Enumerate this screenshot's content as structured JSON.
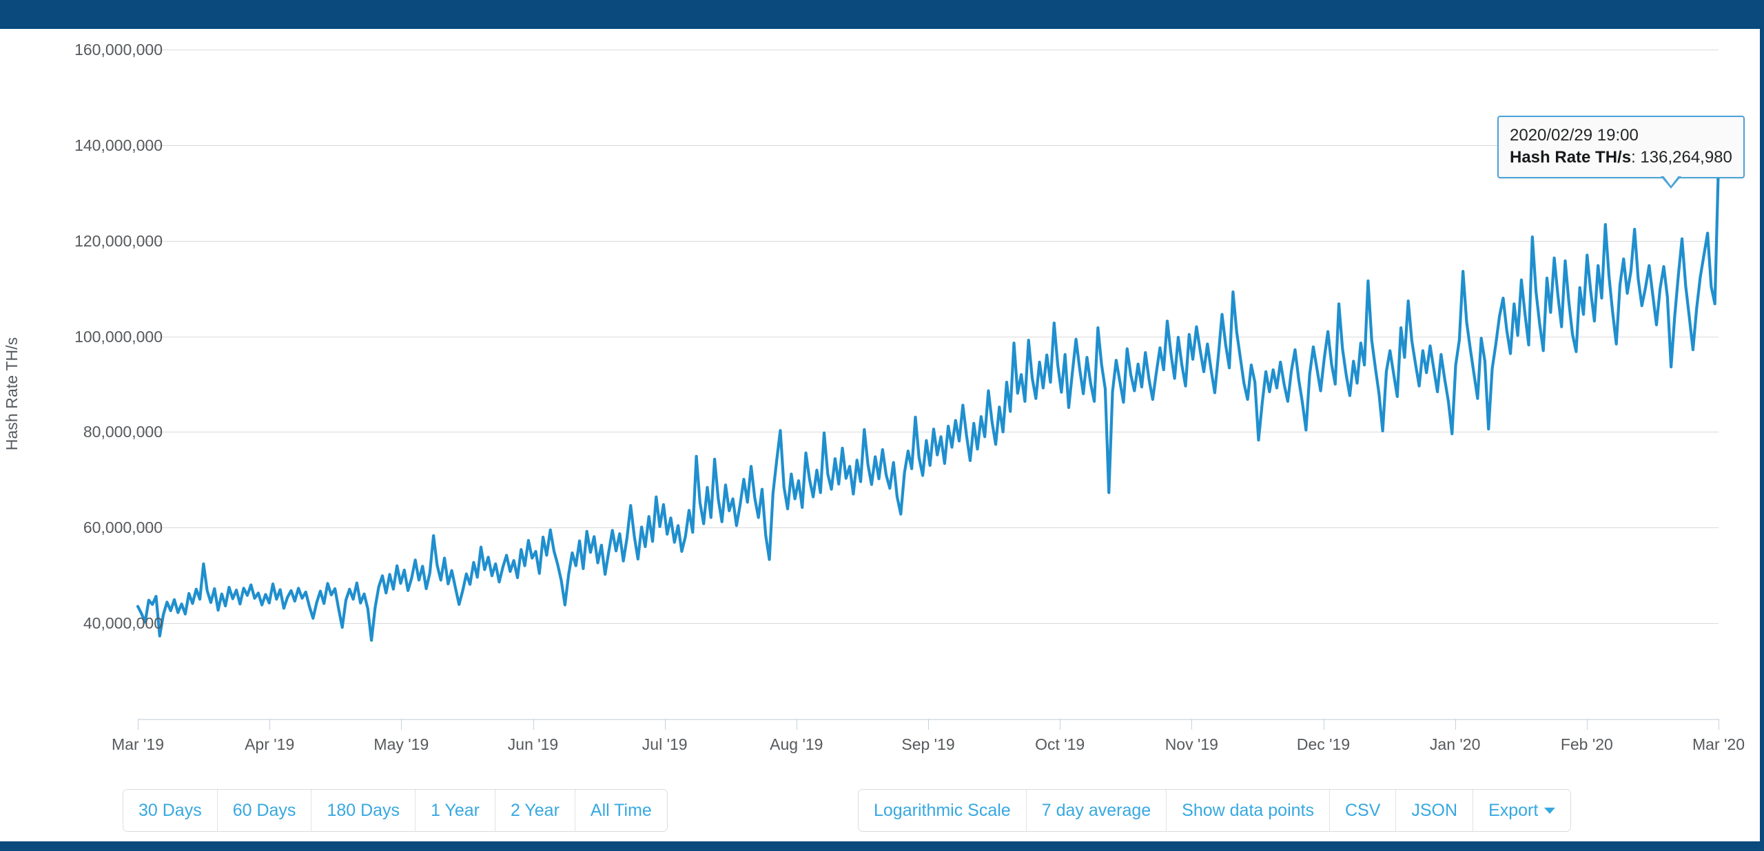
{
  "page": {
    "theme_bar_color": "#0a4a7d",
    "accent_color": "#37a8e0",
    "line_color": "#1f8fce"
  },
  "tooltip": {
    "timestamp": "2020/02/29 19:00",
    "metric_label": "Hash Rate TH/s",
    "separator": ": ",
    "value": "136,264,980"
  },
  "range_buttons": [
    {
      "label": "30 Days",
      "name": "range-30-days"
    },
    {
      "label": "60 Days",
      "name": "range-60-days"
    },
    {
      "label": "180 Days",
      "name": "range-180-days"
    },
    {
      "label": "1 Year",
      "name": "range-1-year"
    },
    {
      "label": "2 Year",
      "name": "range-2-year"
    },
    {
      "label": "All Time",
      "name": "range-all-time"
    }
  ],
  "option_buttons": [
    {
      "label": "Logarithmic Scale",
      "name": "logarithmic-scale-button"
    },
    {
      "label": "7 day average",
      "name": "seven-day-average-button"
    },
    {
      "label": "Show data points",
      "name": "show-data-points-button"
    },
    {
      "label": "CSV",
      "name": "csv-button"
    },
    {
      "label": "JSON",
      "name": "json-button"
    },
    {
      "label": "Export",
      "name": "export-button"
    }
  ],
  "chart_data": {
    "type": "line",
    "title": "",
    "xlabel": "",
    "ylabel": "Hash Rate TH/s",
    "grid": true,
    "legend": "none",
    "ylim": [
      30000000,
      160000000
    ],
    "ytick_labels": [
      "160,000,000",
      "140,000,000",
      "120,000,000",
      "100,000,000",
      "80,000,000",
      "60,000,000",
      "40,000,000"
    ],
    "ytick_values": [
      160000000,
      140000000,
      120000000,
      100000000,
      80000000,
      60000000,
      40000000
    ],
    "xtick_labels": [
      "Mar '19",
      "Apr '19",
      "May '19",
      "Jun '19",
      "Jul '19",
      "Aug '19",
      "Sep '19",
      "Oct '19",
      "Nov '19",
      "Dec '19",
      "Jan '20",
      "Feb '20",
      "Mar '20"
    ],
    "x_range": [
      "2019-03-01",
      "2020-03-01"
    ],
    "units": "TH/s",
    "series": [
      {
        "name": "Hash Rate TH/s",
        "color": "#1f8fce",
        "values": [
          43.5,
          42.0,
          40.2,
          44.8,
          43.9,
          45.6,
          37.3,
          41.8,
          44.4,
          42.6,
          44.9,
          42.2,
          44.0,
          41.9,
          46.2,
          44.1,
          47.1,
          45.0,
          52.4,
          46.8,
          44.3,
          47.2,
          42.7,
          46.1,
          43.6,
          47.5,
          45.1,
          46.9,
          44.0,
          47.3,
          45.8,
          48.0,
          45.2,
          46.3,
          43.8,
          46.0,
          44.2,
          48.2,
          45.0,
          47.0,
          43.1,
          45.4,
          46.8,
          44.6,
          47.3,
          45.2,
          46.5,
          43.5,
          41.0,
          44.3,
          46.7,
          44.1,
          48.3,
          45.9,
          47.2,
          43.0,
          39.1,
          44.8,
          47.1,
          45.0,
          48.4,
          44.2,
          46.1,
          43.0,
          36.4,
          43.2,
          47.6,
          49.9,
          46.3,
          50.2,
          47.1,
          52.0,
          48.3,
          51.1,
          46.8,
          49.4,
          53.2,
          49.0,
          51.9,
          47.2,
          50.5,
          58.3,
          52.1,
          49.0,
          53.6,
          48.2,
          51.0,
          47.4,
          43.9,
          46.8,
          50.3,
          48.1,
          52.7,
          49.6,
          55.9,
          51.2,
          53.8,
          49.9,
          52.4,
          48.6,
          51.7,
          54.2,
          50.8,
          53.1,
          49.5,
          55.4,
          52.0,
          57.3,
          53.6,
          55.0,
          50.4,
          58.0,
          54.2,
          59.5,
          55.1,
          52.3,
          48.9,
          43.8,
          50.1,
          54.7,
          52.0,
          57.2,
          51.4,
          59.2,
          54.8,
          58.1,
          52.6,
          56.3,
          50.2,
          54.9,
          59.4,
          55.1,
          58.7,
          53.0,
          57.8,
          64.6,
          58.2,
          53.4,
          60.1,
          56.0,
          62.3,
          57.1,
          66.4,
          60.2,
          64.8,
          58.6,
          62.0,
          56.9,
          60.4,
          55.0,
          58.1,
          63.6,
          59.0,
          74.9,
          65.2,
          60.8,
          68.4,
          62.1,
          74.3,
          66.0,
          61.2,
          68.9,
          63.5,
          66.0,
          60.4,
          64.8,
          70.1,
          65.3,
          72.8,
          66.2,
          62.1,
          68.0,
          58.4,
          53.3,
          67.2,
          74.0,
          80.3,
          68.5,
          63.9,
          71.2,
          66.0,
          69.8,
          64.2,
          75.6,
          70.1,
          66.4,
          72.0,
          67.3,
          79.8,
          71.2,
          68.0,
          74.4,
          69.1,
          76.6,
          70.3,
          72.8,
          67.0,
          74.1,
          69.6,
          80.5,
          73.2,
          69.0,
          74.8,
          70.2,
          76.3,
          71.0,
          68.2,
          73.6,
          66.4,
          62.8,
          71.4,
          76.0,
          72.3,
          83.1,
          74.6,
          70.9,
          78.2,
          73.0,
          80.6,
          75.2,
          79.0,
          73.4,
          81.2,
          76.8,
          82.4,
          78.1,
          85.6,
          79.3,
          74.0,
          81.8,
          76.4,
          83.2,
          79.0,
          88.6,
          82.1,
          77.4,
          85.2,
          80.0,
          90.4,
          84.3,
          98.6,
          88.1,
          92.0,
          86.4,
          99.2,
          91.3,
          87.0,
          94.6,
          89.2,
          96.1,
          90.4,
          102.8,
          94.0,
          88.3,
          96.2,
          85.1,
          92.4,
          99.4,
          93.2,
          88.0,
          95.6,
          90.2,
          86.4,
          101.8,
          94.1,
          89.0,
          67.3,
          88.4,
          95.0,
          90.6,
          86.2,
          97.4,
          92.0,
          88.6,
          94.2,
          89.4,
          96.6,
          91.0,
          86.8,
          92.4,
          97.6,
          93.0,
          103.2,
          96.4,
          91.2,
          99.8,
          94.0,
          89.6,
          100.4,
          95.2,
          102.0,
          97.1,
          92.6,
          98.4,
          93.0,
          88.2,
          96.0,
          104.6,
          98.2,
          93.4,
          109.3,
          101.0,
          95.6,
          90.2,
          86.8,
          94.0,
          90.4,
          78.3,
          86.0,
          92.6,
          88.4,
          93.0,
          89.2,
          94.6,
          90.0,
          86.4,
          92.8,
          97.2,
          91.0,
          86.2,
          80.4,
          92.0,
          97.8,
          93.2,
          88.6,
          95.4,
          101.0,
          94.2,
          90.0,
          106.8,
          97.4,
          92.0,
          87.6,
          94.8,
          90.2,
          98.6,
          94.0,
          111.6,
          99.2,
          93.4,
          88.0,
          80.2,
          92.6,
          97.0,
          92.2,
          87.4,
          101.8,
          95.6,
          107.4,
          99.0,
          94.2,
          89.6,
          97.0,
          92.4,
          98.0,
          93.2,
          88.4,
          96.2,
          91.0,
          86.4,
          79.6,
          94.0,
          99.2,
          113.6,
          103.0,
          97.4,
          92.2,
          87.0,
          99.6,
          94.8,
          80.6,
          93.2,
          98.4,
          104.2,
          108.0,
          101.2,
          96.4,
          106.8,
          100.2,
          111.8,
          104.6,
          98.2,
          120.8,
          109.4,
          102.6,
          97.0,
          112.2,
          105.0,
          116.4,
          108.6,
          102.0,
          115.8,
          107.2,
          100.4,
          96.8,
          110.2,
          104.6,
          117.0,
          109.4,
          103.2,
          114.8,
          108.0,
          123.4,
          112.6,
          105.0,
          98.4,
          110.8,
          116.2,
          109.0,
          113.6,
          122.4,
          112.0,
          106.4,
          110.2,
          114.8,
          108.6,
          102.4,
          110.0,
          114.6,
          108.2,
          93.6,
          104.2,
          112.8,
          120.4,
          110.6,
          104.0,
          97.2,
          105.8,
          112.4,
          117.0,
          121.6,
          110.4,
          106.8,
          136.3
        ]
      }
    ]
  }
}
